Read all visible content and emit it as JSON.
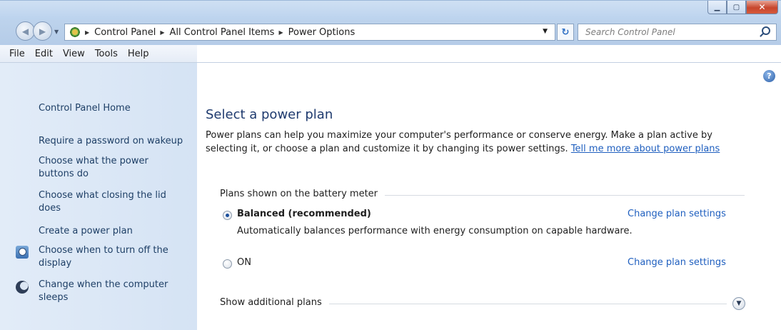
{
  "window": {
    "minimize_glyph": "▁",
    "maximize_glyph": "▢",
    "close_glyph": "✕"
  },
  "nav": {
    "back_glyph": "◀",
    "forward_glyph": "▶",
    "breadcrumbs": [
      "Control Panel",
      "All Control Panel Items",
      "Power Options"
    ],
    "refresh_glyph": "↻",
    "search_placeholder": "Search Control Panel"
  },
  "menu": [
    "File",
    "Edit",
    "View",
    "Tools",
    "Help"
  ],
  "sidebar": {
    "home": "Control Panel Home",
    "links": [
      "Require a password on wakeup",
      "Choose what the power buttons do",
      "Choose what closing the lid does",
      "Create a power plan",
      "Choose when to turn off the display",
      "Change when the computer sleeps"
    ]
  },
  "main": {
    "title": "Select a power plan",
    "intro_text": "Power plans can help you maximize your computer's performance or conserve energy. Make a plan active by selecting it, or choose a plan and customize it by changing its power settings. ",
    "intro_link": "Tell me more about power plans",
    "group_label": "Plans shown on the battery meter",
    "plans": [
      {
        "name": "Balanced (recommended)",
        "selected": true,
        "description": "Automatically balances performance with energy consumption on capable hardware.",
        "link": "Change plan settings"
      },
      {
        "name": "ON",
        "selected": false,
        "description": "",
        "link": "Change plan settings"
      }
    ],
    "show_more": "Show additional plans"
  }
}
